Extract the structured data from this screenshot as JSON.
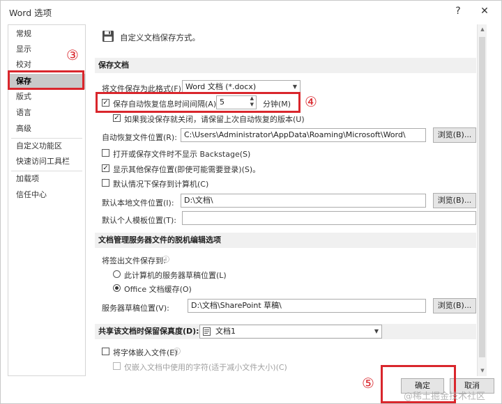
{
  "window": {
    "title": "Word 选项",
    "help": "?",
    "close": "✕"
  },
  "sidebar": {
    "items": [
      "常规",
      "显示",
      "校对",
      "保存",
      "版式",
      "语言",
      "高级",
      "自定义功能区",
      "快速访问工具栏",
      "加载项",
      "信任中心"
    ],
    "active": "保存"
  },
  "header": {
    "text": "自定义文档保存方式。"
  },
  "save_section": {
    "title": "保存文档",
    "format_label": "将文件保存为此格式(F):",
    "format_value": "Word 文档 (*.docx)",
    "autorecover_label": "保存自动恢复信息时间间隔(A)",
    "autorecover_value": "5",
    "minutes_label": "分钟(M)",
    "keep_last_label": "如果我没保存就关闭，请保留上次自动恢复的版本(U)",
    "autorecover_location_label": "自动恢复文件位置(R):",
    "autorecover_location_value": "C:\\Users\\Administrator\\AppData\\Roaming\\Microsoft\\Word\\",
    "browse_label": "浏览(B)...",
    "no_backstage_label": "打开或保存文件时不显示 Backstage(S)",
    "show_locations_label": "显示其他保存位置(即使可能需要登录)(S)。",
    "save_to_computer_label": "默认情况下保存到计算机(C)",
    "default_local_label": "默认本地文件位置(I):",
    "default_local_value": "D:\\文档\\",
    "template_label": "默认个人模板位置(T):",
    "template_value": ""
  },
  "offline_section": {
    "title": "文档管理服务器文件的脱机编辑选项",
    "save_checkout_label": "将签出文件保存到:",
    "info_icon": "ⓘ",
    "option_server_label": "此计算机的服务器草稿位置(L)",
    "option_cache_label": "Office 文档缓存(O)",
    "server_drafts_label": "服务器草稿位置(V):",
    "server_drafts_value": "D:\\文档\\SharePoint 草稿\\",
    "browse_label": "浏览(B)..."
  },
  "fidelity_section": {
    "title": "共享该文档时保留保真度(D):",
    "doc_value": "文档1",
    "embed_fonts_label": "将字体嵌入文件(E)",
    "embed_used_label": "仅嵌入文档中使用的字符(适于减小文件大小)(C)"
  },
  "footer": {
    "ok_label": "确定",
    "cancel_label": "取消"
  },
  "annotations": {
    "n3": "③",
    "n4": "④",
    "n5": "⑤"
  },
  "watermark": "@稀土掘金技术社区",
  "colors": {
    "annotation_red": "#d9262c",
    "active_nav": "#c9c9c9",
    "section_bar": "#f0f0f0"
  }
}
